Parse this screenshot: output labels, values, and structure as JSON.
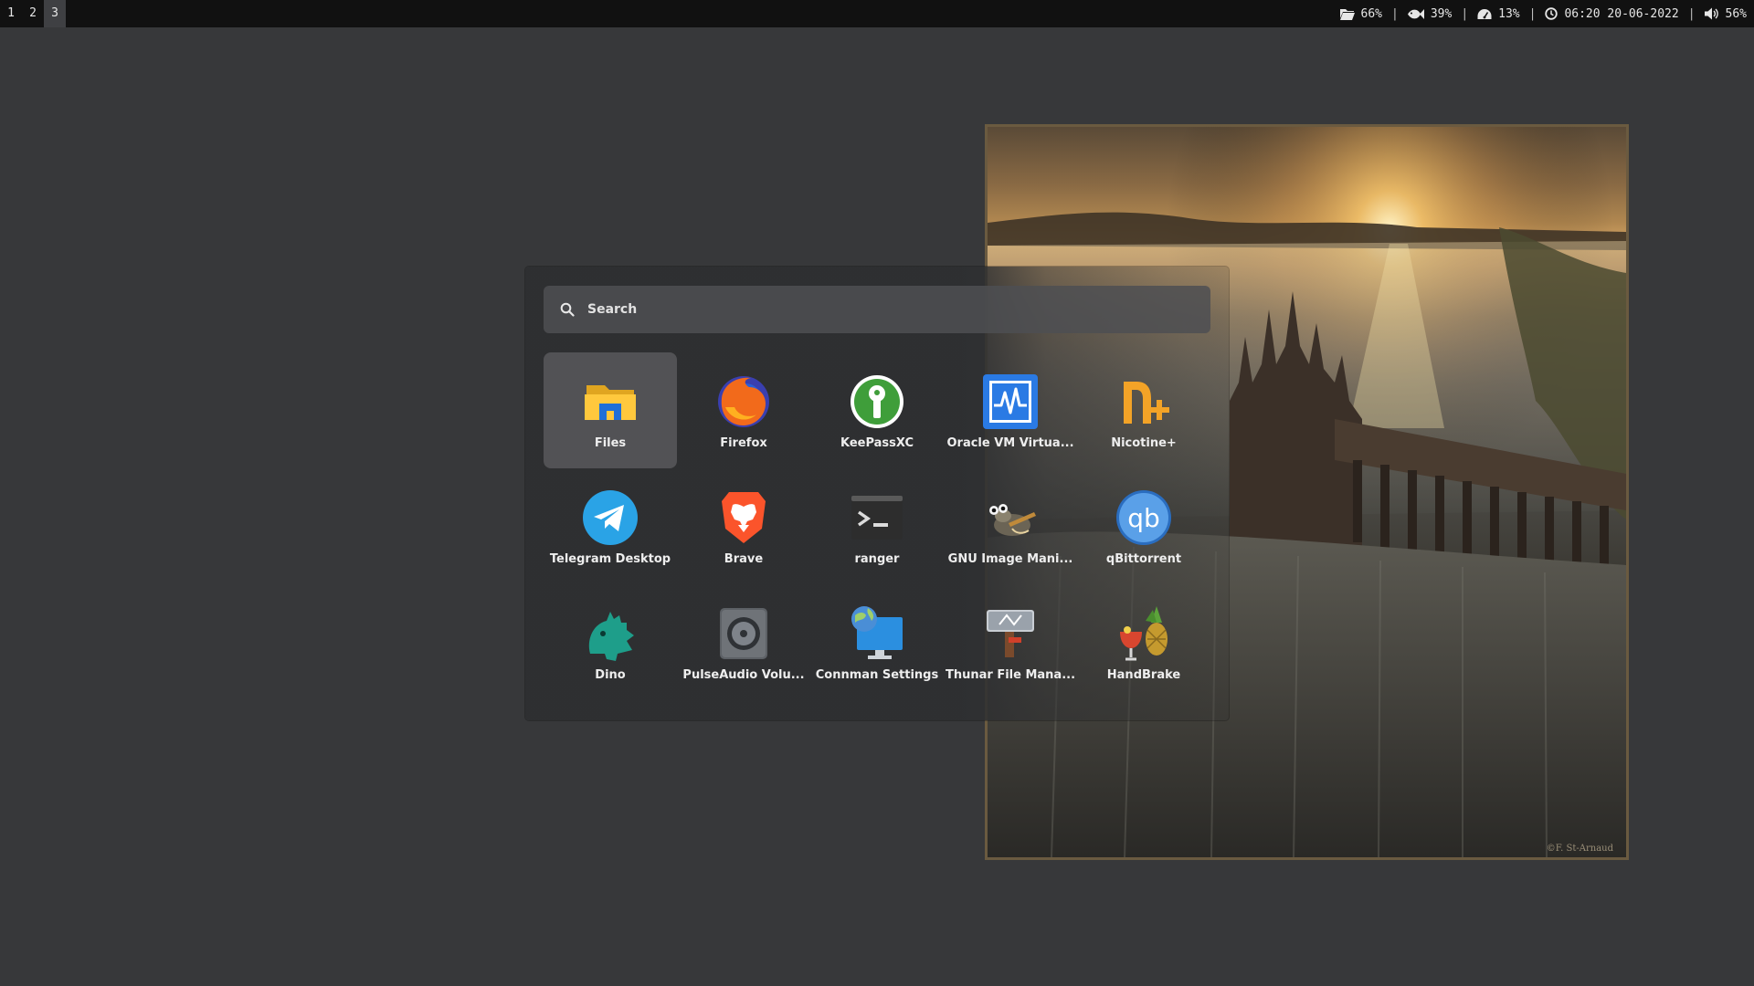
{
  "workspaces": [
    {
      "label": "1",
      "active": false
    },
    {
      "label": "2",
      "active": false
    },
    {
      "label": "3",
      "active": true
    }
  ],
  "status": {
    "disk": {
      "icon": "folder-icon",
      "value": "66%"
    },
    "memory": {
      "icon": "fish-icon",
      "value": "39%"
    },
    "cpu": {
      "icon": "speedometer-icon",
      "value": "13%"
    },
    "clock": {
      "icon": "clock-icon",
      "value": "06:20 20-06-2022"
    },
    "volume": {
      "icon": "speaker-icon",
      "value": "56%"
    },
    "separator": "|"
  },
  "launcher": {
    "search": {
      "placeholder": "Search",
      "value": "",
      "icon": "search-icon"
    },
    "apps": [
      {
        "label": "Files",
        "icon": "folder-icon",
        "selected": true
      },
      {
        "label": "Firefox",
        "icon": "firefox-icon"
      },
      {
        "label": "KeePassXC",
        "icon": "keepassxc-icon"
      },
      {
        "label": "Oracle VM Virtua...",
        "icon": "virtualbox-monitor-icon"
      },
      {
        "label": "Nicotine+",
        "icon": "nicotine-icon"
      },
      {
        "label": "Telegram Desktop",
        "icon": "telegram-icon"
      },
      {
        "label": "Brave",
        "icon": "brave-lion-icon"
      },
      {
        "label": "ranger",
        "icon": "terminal-icon"
      },
      {
        "label": "GNU Image Mani...",
        "icon": "gimp-icon"
      },
      {
        "label": "qBittorrent",
        "icon": "qbittorrent-icon"
      },
      {
        "label": "Dino",
        "icon": "dino-icon"
      },
      {
        "label": "PulseAudio Volu...",
        "icon": "speaker-icon"
      },
      {
        "label": "Connman Settings",
        "icon": "globe-monitor-icon"
      },
      {
        "label": "Thunar File Mana...",
        "icon": "thunar-icon"
      },
      {
        "label": "HandBrake",
        "icon": "handbrake-icon"
      }
    ]
  },
  "wallpaper": {
    "credit": "©F. St-Arnaud"
  },
  "colors": {
    "bar": "#111111",
    "desktop": "#37383a",
    "launcher": "#2e2f31",
    "selection": "#56575a"
  }
}
